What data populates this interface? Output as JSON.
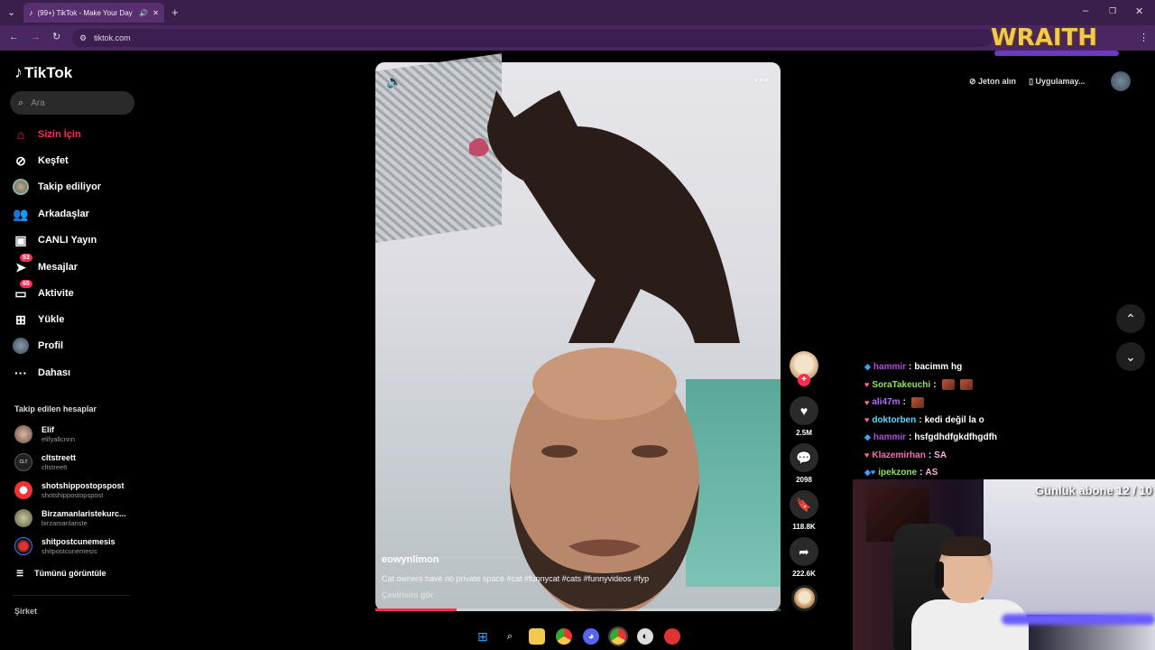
{
  "browser": {
    "tab_title": "(99+) TikTok - Make Your Day",
    "url": "tiktok.com",
    "streamer_logo": "WRAITH"
  },
  "sidebar": {
    "logo": "TikTok",
    "search_placeholder": "Ara",
    "nav": [
      {
        "label": "Sizin İçin",
        "icon": "home-icon",
        "active": true
      },
      {
        "label": "Keşfet",
        "icon": "compass-icon"
      },
      {
        "label": "Takip ediliyor",
        "icon": "following-avatar-icon"
      },
      {
        "label": "Arkadaşlar",
        "icon": "friends-icon"
      },
      {
        "label": "CANLI Yayın",
        "icon": "live-icon"
      },
      {
        "label": "Mesajlar",
        "icon": "messages-icon",
        "badge": "53"
      },
      {
        "label": "Aktivite",
        "icon": "activity-icon",
        "badge": "65"
      },
      {
        "label": "Yükle",
        "icon": "upload-icon"
      },
      {
        "label": "Profil",
        "icon": "profile-avatar-icon"
      },
      {
        "label": "Dahası",
        "icon": "more-icon"
      }
    ],
    "following_title": "Takip edilen hesaplar",
    "following": [
      {
        "name": "Elif",
        "handle": "elifyallcnnn"
      },
      {
        "name": "cltstreett",
        "handle": "cltstreett"
      },
      {
        "name": "shotshippostopspost",
        "handle": "shotshippostopspost"
      },
      {
        "name": "Birzamanlaristekurc...",
        "handle": "birzamanlariste"
      },
      {
        "name": "shitpostcunemesis",
        "handle": "shitpostcunemesis"
      }
    ],
    "see_all": "Tümünü görüntüle",
    "company": "Şirket"
  },
  "video": {
    "author": "eowynlimon",
    "caption": "Cat owners have no private space #cat #funnycat #cats #funnyvideos #fyp",
    "translate": "Çevirisini gör",
    "progress": 0.2,
    "likes": "2.5M",
    "comments": "2098",
    "saves": "118.8K",
    "shares": "222.6K"
  },
  "topright": {
    "coins": "Jeton alın",
    "app": "Uygulamay..."
  },
  "chat": [
    {
      "user": "hammir",
      "color": "#b04ad8",
      "badge": "◆",
      "badge_color": "#3aa0ff",
      "msg": "bacimm hg"
    },
    {
      "user": "SoraTakeuchi",
      "color": "#8ee35a",
      "badge": "♥",
      "badge_color": "#ff6b9a",
      "msg": "",
      "emotes": 2
    },
    {
      "user": "ali47m",
      "color": "#b06cff",
      "badge": "♥",
      "badge_color": "#ff6b9a",
      "msg": "",
      "emotes": 1
    },
    {
      "user": "doktorben",
      "color": "#5ad8ff",
      "badge": "♥",
      "badge_color": "#ff6b9a",
      "msg": "kedi değil la o"
    },
    {
      "user": "hammir",
      "color": "#b04ad8",
      "badge": "◆",
      "badge_color": "#3aa0ff",
      "msg": "hsfgdhdfgkdfhgdfh"
    },
    {
      "user": "Klazemirhan",
      "color": "#ff6bb0",
      "badge": "♥",
      "badge_color": "#ff6b9a",
      "msg": "SA"
    },
    {
      "user": "ipekzone",
      "color": "#8ee35a",
      "badge": "◆♥",
      "badge_color": "#3aa0ff",
      "msg": "AS"
    }
  ],
  "sub_goal": "Günlük abone 12 / 10",
  "colors": {
    "accent": "#fe2c55",
    "chrome": "#4a2760"
  }
}
